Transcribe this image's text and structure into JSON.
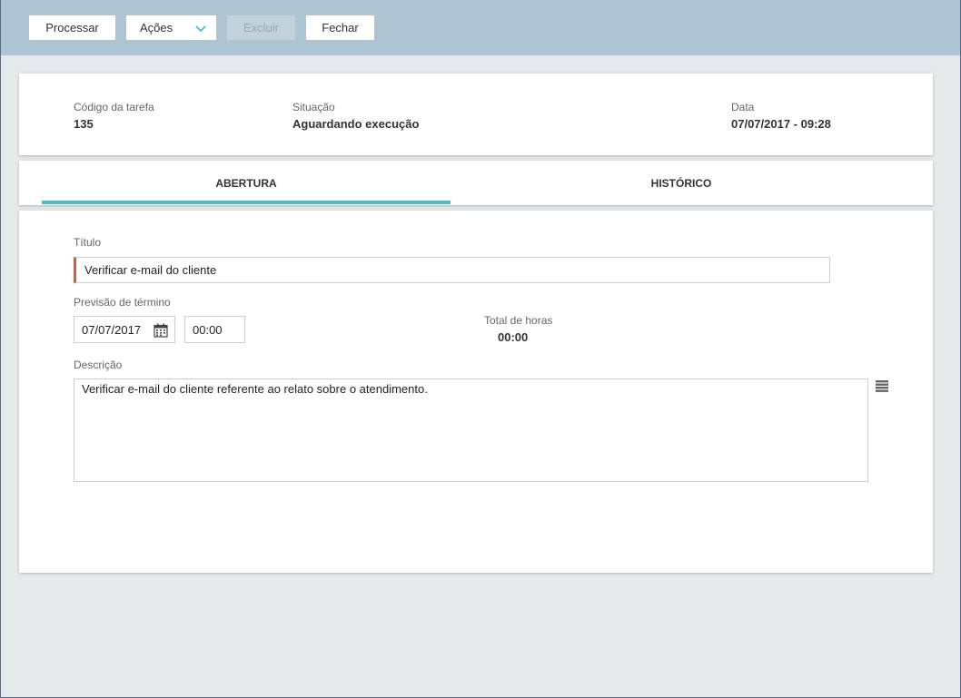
{
  "toolbar": {
    "processar_label": "Processar",
    "acoes_label": "Ações",
    "excluir_label": "Excluir",
    "fechar_label": "Fechar",
    "acoes_chevron_icon": "chevron-down-icon",
    "background_color": "#adc4d3",
    "disabled_button_color": "#c2d2dd"
  },
  "info": {
    "codigo_label": "Código da tarefa",
    "codigo_value": "135",
    "situacao_label": "Situação",
    "situacao_value": "Aguardando execução",
    "data_label": "Data",
    "data_value": "07/07/2017 - 09:28"
  },
  "tabs": [
    {
      "label": "ABERTURA",
      "active": true
    },
    {
      "label": "HISTÓRICO",
      "active": false
    }
  ],
  "form": {
    "titulo_label": "Título",
    "titulo_value": "Verificar e-mail do cliente",
    "previsao_label": "Previsão de término",
    "previsao_date": "07/07/2017",
    "previsao_time": "00:00",
    "calendar_icon": "calendar-icon",
    "total_horas_label": "Total de horas",
    "total_horas_value": "00:00",
    "descricao_label": "Descrição",
    "descricao_value": "Verificar e-mail do cliente referente ao relato sobre o atendimento.",
    "menu_icon": "hamburger-menu-icon"
  },
  "colors": {
    "accent": "#4cbcbc",
    "required_marker": "#c4604a",
    "page_background": "#e5e9ec"
  }
}
